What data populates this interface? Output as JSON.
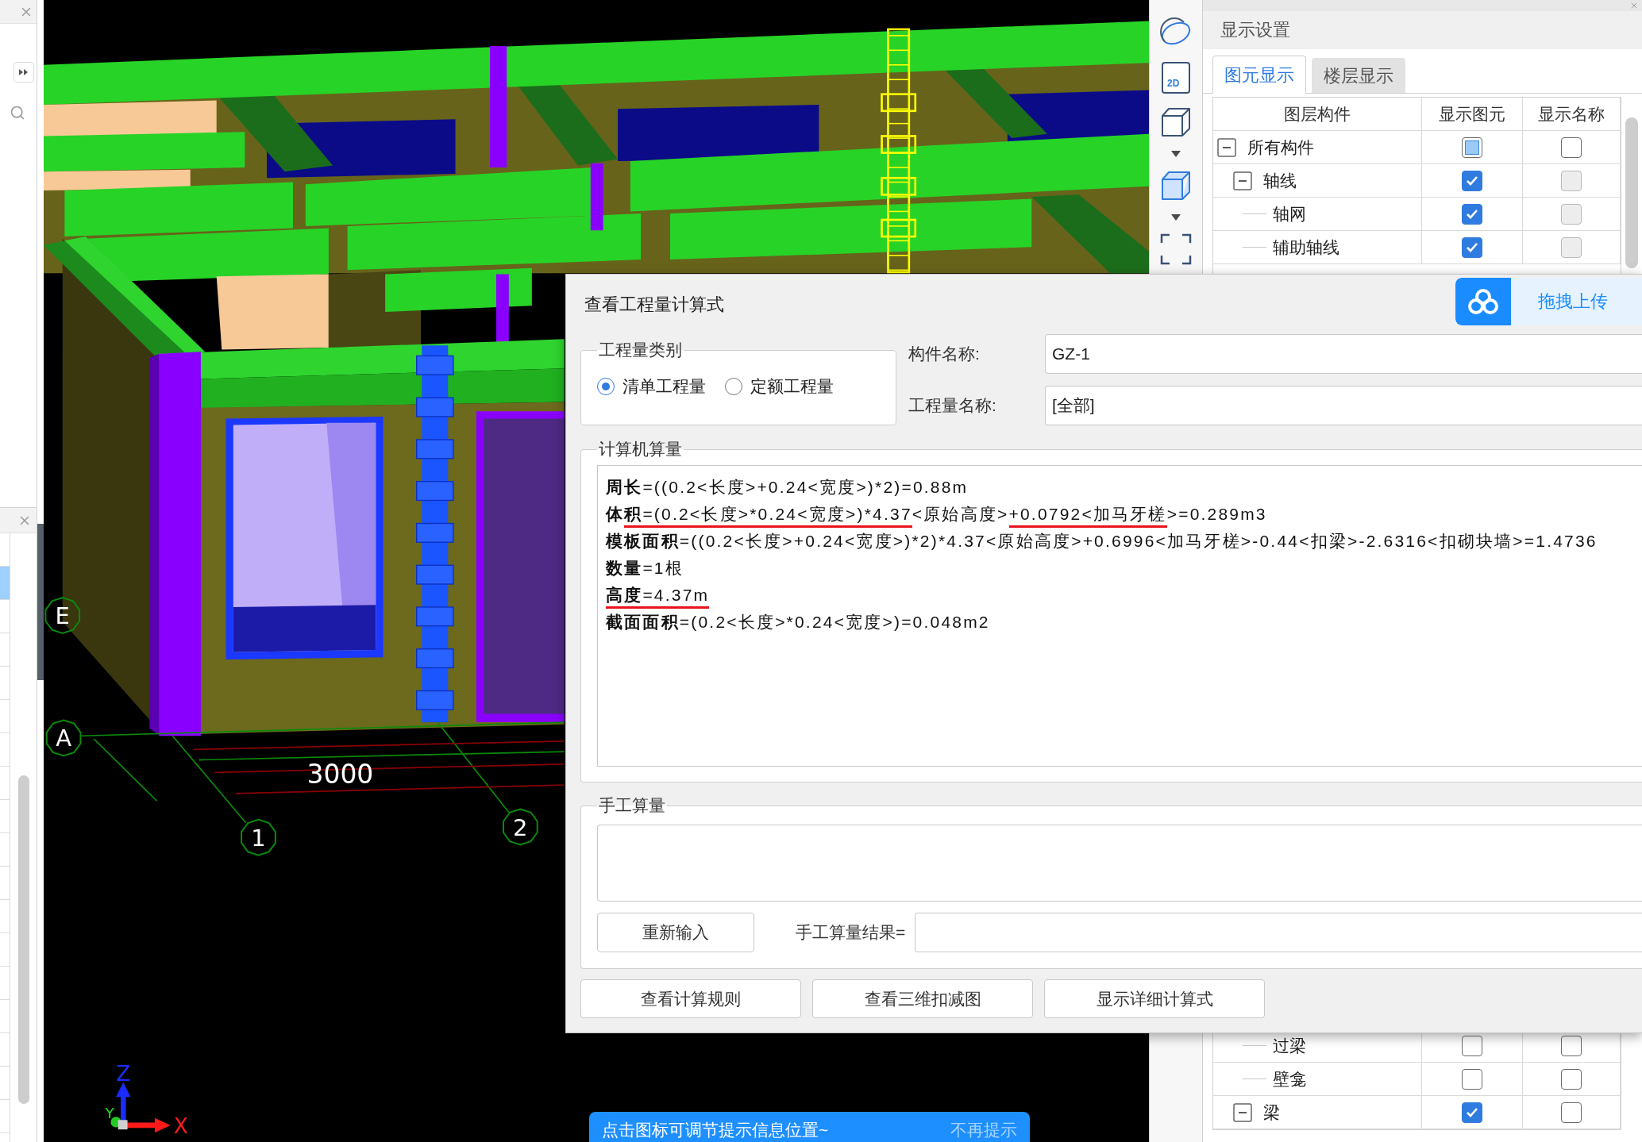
{
  "left_sidebar": {
    "list_rows": [
      {
        "selected": false
      },
      {
        "selected": true
      },
      {
        "selected": false
      },
      {
        "selected": false
      },
      {
        "selected": false
      },
      {
        "selected": false
      },
      {
        "selected": false
      },
      {
        "selected": false
      },
      {
        "selected": false
      },
      {
        "selected": false
      },
      {
        "selected": false
      },
      {
        "selected": false
      },
      {
        "selected": false
      },
      {
        "selected": false
      },
      {
        "selected": false
      },
      {
        "selected": false
      },
      {
        "selected": false
      },
      {
        "selected": false
      }
    ]
  },
  "viewport": {
    "grid_bubbles": [
      {
        "text": "E"
      },
      {
        "text": "A"
      },
      {
        "text": "1"
      },
      {
        "text": "2"
      }
    ],
    "dimension": "3000",
    "axis_letters": {
      "x": "X",
      "y": "Y",
      "z": "Z"
    }
  },
  "view_toolbar": {
    "buttons": [
      {
        "kind": "orbit",
        "menu": false
      },
      {
        "kind": "flat",
        "label": "2D",
        "menu": false
      },
      {
        "kind": "box",
        "menu": true
      },
      {
        "kind": "solid",
        "menu": true
      },
      {
        "kind": "frame",
        "menu": false
      }
    ]
  },
  "display_panel": {
    "title": "显示设置",
    "tabs": [
      {
        "label": "图元显示",
        "selected": true
      },
      {
        "label": "楼层显示",
        "selected": false
      }
    ],
    "columns": [
      "图层构件",
      "显示图元",
      "显示名称"
    ],
    "tree": [
      {
        "label": "所有构件",
        "expanded": true,
        "element_checked": false,
        "element_partial": true,
        "name_checked": false,
        "name_disabled": false,
        "children": [
          {
            "label": "轴线",
            "expanded": true,
            "element_checked": true,
            "element_partial": false,
            "name_checked": false,
            "name_disabled": true,
            "children": [
              {
                "label": "轴网",
                "element_checked": true,
                "element_partial": false,
                "name_checked": false,
                "name_disabled": true
              },
              {
                "label": "辅助轴线",
                "element_checked": true,
                "element_partial": false,
                "name_checked": false,
                "name_disabled": true
              }
            ]
          }
        ]
      }
    ],
    "tree_lower": [
      {
        "children": [
          {
            "label": "过梁",
            "element_checked": false,
            "element_partial": false,
            "name_checked": false,
            "name_disabled": false
          },
          {
            "label": "壁龛",
            "element_checked": false,
            "element_partial": false,
            "name_checked": false,
            "name_disabled": false
          }
        ]
      },
      {
        "label": "梁",
        "expanded": true,
        "element_checked": true,
        "element_partial": false,
        "name_checked": false,
        "name_disabled": false
      }
    ]
  },
  "dialog": {
    "title": "查看工程量计算式",
    "upload_label": "拖拽上传",
    "quantity_type": {
      "legend": "工程量类别",
      "options": [
        {
          "label": "清单工程量",
          "selected": true
        },
        {
          "label": "定额工程量",
          "selected": false
        }
      ]
    },
    "fields": [
      {
        "label": "构件名称:",
        "value": "GZ-1"
      },
      {
        "label": "工程量名称:",
        "value": "[全部]"
      }
    ],
    "computed": {
      "legend": "计算机算量",
      "lines": [
        {
          "parts": [
            {
              "text": "**周长**=((0.2<长度>+0.24<宽度>)*2)=0.88m",
              "underlined": false
            }
          ]
        },
        {
          "parts": [
            {
              "text": "**体**",
              "underlined": false
            },
            {
              "text": "**积**=(0.2<长度>*0.24<宽度>)*4.37",
              "underlined": true
            },
            {
              "text": "<原始高度>",
              "underlined": false
            },
            {
              "text": "+0.0792<加马牙槎",
              "underlined": true
            },
            {
              "text": ">=0.289m3",
              "underlined": false
            }
          ]
        },
        {
          "parts": [
            {
              "text": "**模板面积**=((0.2<长度>+0.24<宽度>)*2)*4.37<原始高度>+0.6996<加马牙槎>-0.44<扣梁>-2.6316<扣砌块墙>=1.4736",
              "underlined": false
            }
          ]
        },
        {
          "parts": [
            {
              "text": "**数量**=1根",
              "underlined": false
            }
          ]
        },
        {
          "parts": [
            {
              "text": "**高度**=4.37m",
              "underlined": true
            }
          ]
        },
        {
          "parts": [
            {
              "text": "**截面面积**=(0.2<长度>*0.24<宽度>)=0.048m2",
              "underlined": false
            }
          ]
        }
      ]
    },
    "manual": {
      "legend": "手工算量",
      "reset_button": "重新输入",
      "result_label": "手工算量结果="
    },
    "buttons": [
      "查看计算规则",
      "查看三维扣减图",
      "显示详细计算式"
    ]
  },
  "hint_bubble": {
    "message": "点击图标可调节提示信息位置~",
    "dismiss": "不再提示"
  }
}
